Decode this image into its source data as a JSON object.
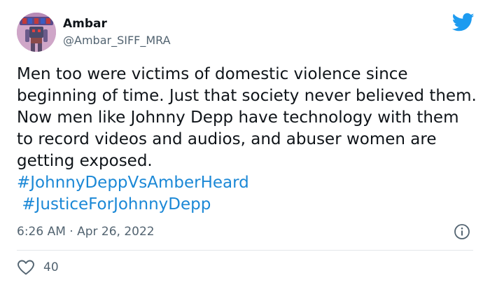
{
  "tweet": {
    "author": {
      "display_name": "Ambar",
      "handle": "@Ambar_SIFF_MRA",
      "avatar_icon": "robot-avatar"
    },
    "brand_icon": "twitter-bird-icon",
    "body_text": "Men too were victims of domestic violence since beginning of time. Just that society never believed them. Now men like Johnny Depp have technology with them to record videos and audios, and abuser women are getting exposed.",
    "hashtags": [
      "#JohnnyDeppVsAmberHeard",
      "#JusticeForJohnnyDepp"
    ],
    "timestamp": "6:26 AM · Apr 26, 2022",
    "likes": "40"
  },
  "colors": {
    "text": "#0f1419",
    "secondary": "#536471",
    "link": "#1b88d6",
    "brand": "#1d9bf0"
  }
}
